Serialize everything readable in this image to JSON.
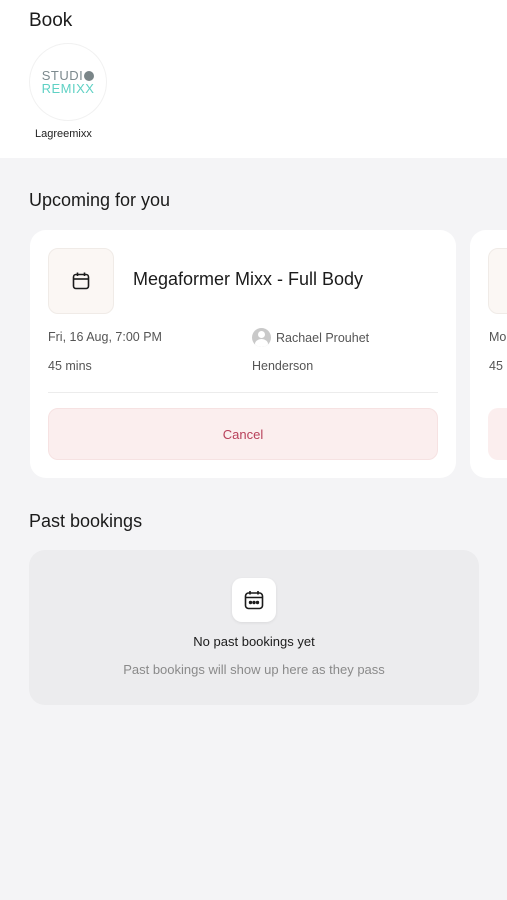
{
  "header": {
    "title": "Book",
    "studio": {
      "logo_line1": "STUDI",
      "logo_line2": "REMIXX",
      "name": "Lagreemixx"
    }
  },
  "upcoming": {
    "section_title": "Upcoming for you",
    "cards": [
      {
        "title": "Megaformer Mixx - Full Body",
        "datetime": "Fri, 16 Aug, 7:00 PM",
        "duration": "45 mins",
        "instructor": "Rachael Prouhet",
        "location": "Henderson",
        "cancel_label": "Cancel"
      },
      {
        "datetime_partial": "Mo",
        "duration_partial": "45"
      }
    ]
  },
  "past": {
    "section_title": "Past bookings",
    "empty_title": "No past bookings yet",
    "empty_subtitle": "Past bookings will show up here as they pass"
  },
  "colors": {
    "background": "#f4f4f6",
    "card": "#ffffff",
    "cancel_bg": "#fbeeee",
    "cancel_text": "#b8405a",
    "logo_teal": "#5fd1c4"
  }
}
